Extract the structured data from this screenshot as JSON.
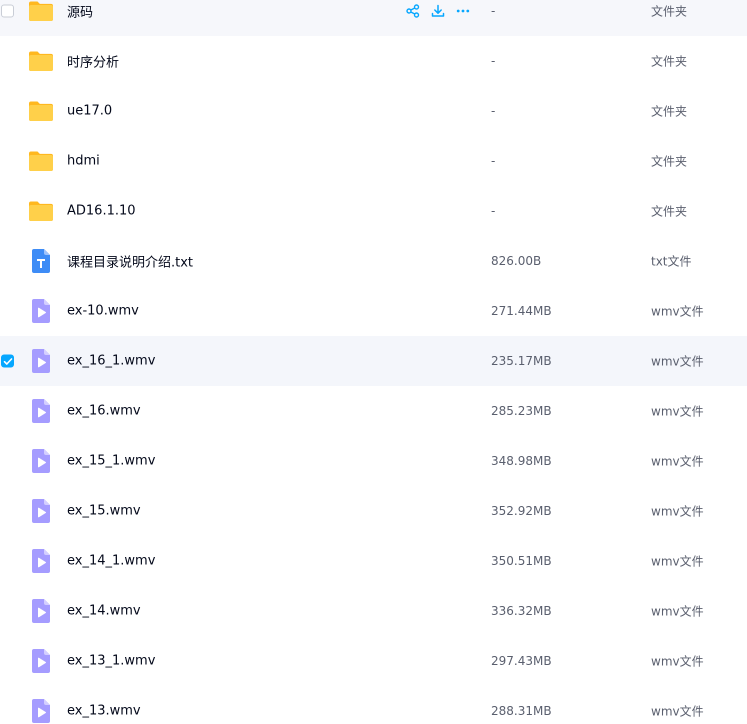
{
  "files": [
    {
      "name": "源码",
      "size": "-",
      "type": "文件夹",
      "kind": "folder",
      "state": "hover"
    },
    {
      "name": "时序分析",
      "size": "-",
      "type": "文件夹",
      "kind": "folder",
      "state": ""
    },
    {
      "name": "ue17.0",
      "size": "-",
      "type": "文件夹",
      "kind": "folder",
      "state": ""
    },
    {
      "name": "hdmi",
      "size": "-",
      "type": "文件夹",
      "kind": "folder",
      "state": ""
    },
    {
      "name": "AD16.1.10",
      "size": "-",
      "type": "文件夹",
      "kind": "folder",
      "state": ""
    },
    {
      "name": "课程目录说明介绍.txt",
      "size": "826.00B",
      "type": "txt文件",
      "kind": "txt",
      "state": ""
    },
    {
      "name": "ex-10.wmv",
      "size": "271.44MB",
      "type": "wmv文件",
      "kind": "video",
      "state": ""
    },
    {
      "name": "ex_16_1.wmv",
      "size": "235.17MB",
      "type": "wmv文件",
      "kind": "video",
      "state": "selected"
    },
    {
      "name": "ex_16.wmv",
      "size": "285.23MB",
      "type": "wmv文件",
      "kind": "video",
      "state": ""
    },
    {
      "name": "ex_15_1.wmv",
      "size": "348.98MB",
      "type": "wmv文件",
      "kind": "video",
      "state": ""
    },
    {
      "name": "ex_15.wmv",
      "size": "352.92MB",
      "type": "wmv文件",
      "kind": "video",
      "state": ""
    },
    {
      "name": "ex_14_1.wmv",
      "size": "350.51MB",
      "type": "wmv文件",
      "kind": "video",
      "state": ""
    },
    {
      "name": "ex_14.wmv",
      "size": "336.32MB",
      "type": "wmv文件",
      "kind": "video",
      "state": ""
    },
    {
      "name": "ex_13_1.wmv",
      "size": "297.43MB",
      "type": "wmv文件",
      "kind": "video",
      "state": ""
    },
    {
      "name": "ex_13.wmv",
      "size": "288.31MB",
      "type": "wmv文件",
      "kind": "video",
      "state": ""
    }
  ],
  "row_actions": [
    {
      "icon": "share-icon"
    },
    {
      "icon": "download-icon"
    },
    {
      "icon": "more-icon"
    }
  ],
  "colors": {
    "accent": "#06a7ff",
    "folder": "#ffc73b",
    "txt": "#3e8cf6",
    "video": "#9c93ff"
  }
}
